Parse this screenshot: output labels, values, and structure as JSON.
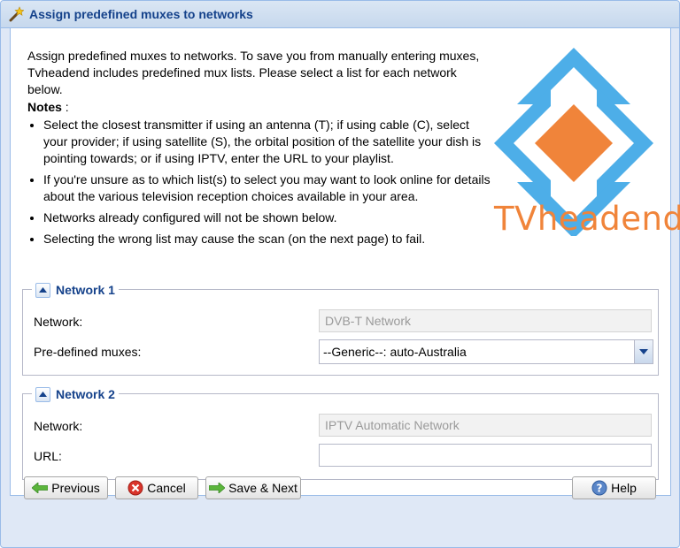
{
  "window": {
    "title": "Assign predefined muxes to networks",
    "title_icon": "wand-icon"
  },
  "intro": {
    "text": "Assign predefined muxes to networks. To save you from manually entering muxes, Tvheadend includes predefined mux lists. Please select a list for each network below.",
    "notes_label": "Notes",
    "notes_suffix": " :",
    "notes": [
      "Select the closest transmitter if using an antenna (T); if using cable (C), select your provider; if using satellite (S), the orbital position of the satellite your dish is pointing towards; or if using IPTV, enter the URL to your playlist.",
      "If you're unsure as to which list(s) to select you may want to look online for details about the various television reception choices available in your area.",
      "Networks already configured will not be shown below.",
      "Selecting the wrong list may cause the scan (on the next page) to fail."
    ]
  },
  "logo": {
    "text": "TVheadend",
    "colors": {
      "blue": "#4daee8",
      "orange": "#f0843a"
    }
  },
  "networks": [
    {
      "legend": "Network 1",
      "network_label": "Network:",
      "network_value": "DVB-T Network",
      "muxes_label": "Pre-defined muxes:",
      "muxes_value": "--Generic--: auto-Australia"
    },
    {
      "legend": "Network 2",
      "network_label": "Network:",
      "network_value": "IPTV Automatic Network",
      "url_label": "URL:",
      "url_value": ""
    }
  ],
  "buttons": {
    "previous": "Previous",
    "cancel": "Cancel",
    "save_next": "Save & Next",
    "help": "Help"
  },
  "colors": {
    "title": "#15428b",
    "border": "#99bbe8",
    "background": "#dfe8f6"
  }
}
